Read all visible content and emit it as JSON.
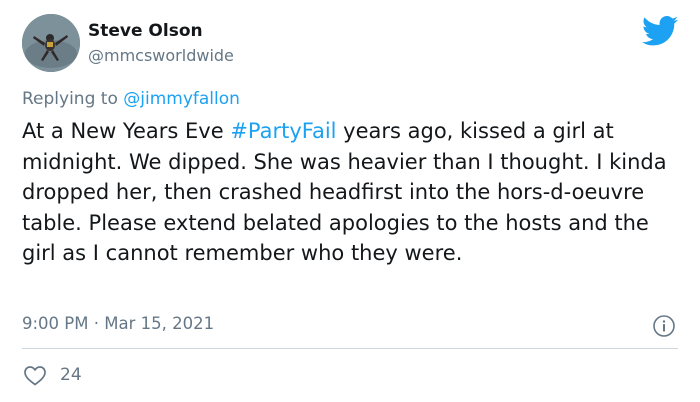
{
  "author": {
    "name": "Steve Olson",
    "handle": "@mmcsworldwide",
    "avatar_icon": "skydiver-avatar"
  },
  "reply": {
    "prefix": "Replying to",
    "mention": "@jimmyfallon"
  },
  "tweet": {
    "text_before": "At a New Years Eve ",
    "hashtag": "#PartyFail",
    "text_after": " years ago, kissed a girl at midnight. We dipped. She was heavier than I thought. I kinda dropped her, then crashed headfirst into the hors-d-oeuvre table. Please extend belated apologies to the hosts and the girl as I cannot remember who they were."
  },
  "meta": {
    "time": "9:00 PM",
    "separator": " · ",
    "date": "Mar 15, 2021"
  },
  "engagement": {
    "likes": "24"
  },
  "icons": {
    "brand": "twitter-bird-icon",
    "info": "info-icon",
    "like": "heart-icon"
  },
  "colors": {
    "brand_blue": "#1da1f2",
    "secondary_text": "#657786",
    "primary_text": "#14171a",
    "divider": "#ccd6dd"
  }
}
